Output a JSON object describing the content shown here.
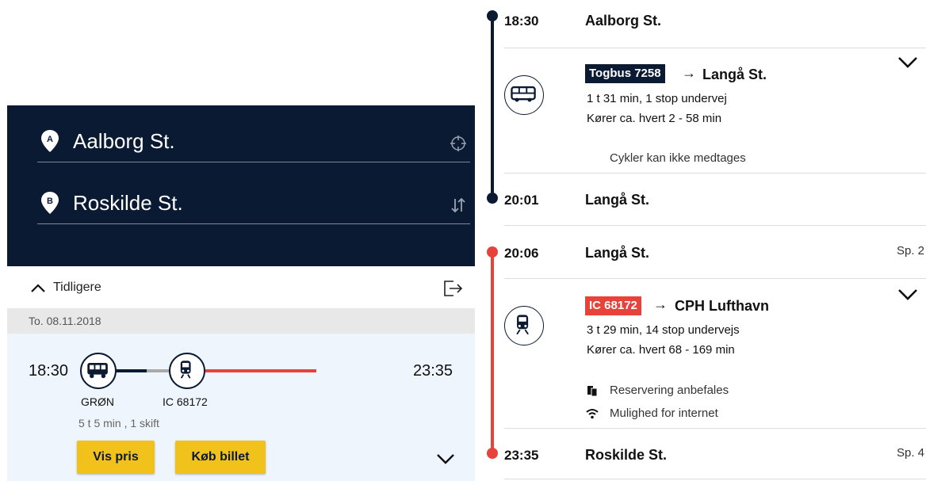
{
  "search": {
    "from_marker": "A",
    "from": "Aalborg St.",
    "to_marker": "B",
    "to": "Roskilde St.",
    "locate_icon": "crosshair-icon",
    "swap_icon": "swap-arrows-icon"
  },
  "results": {
    "earlier_label": "Tidligere",
    "date": "To. 08.11.2018",
    "trip": {
      "departure": "18:30",
      "arrival": "23:35",
      "legs": [
        {
          "icon": "bus-icon",
          "label": "GRØN"
        },
        {
          "icon": "train-icon",
          "label": "IC 68172"
        }
      ],
      "summary": "5 t 5 min , 1 skift",
      "price_button": "Vis pris",
      "buy_button": "Køb billet"
    }
  },
  "detail": {
    "colors": {
      "bus_line": "#0b1a33",
      "train_line": "#e8433a",
      "badge_bus": "#0b1a33",
      "badge_train": "#e8433a"
    },
    "leg1": {
      "start_time": "18:30",
      "start_stop": "Aalborg St.",
      "badge": "Togbus 7258",
      "arrow": "→",
      "destination": "Langå St.",
      "duration": "1 t 31 min, 1 stop undervej",
      "frequency": "Kører ca. hvert 2 - 58 min",
      "note": "Cykler kan ikke medtages",
      "end_time": "20:01",
      "end_stop": "Langå St."
    },
    "leg2": {
      "start_time": "20:06",
      "start_stop": "Langå St.",
      "start_track": "Sp. 2",
      "badge": "IC 68172",
      "arrow": "→",
      "destination": "CPH Lufthavn",
      "duration": "3 t 29 min, 14 stop undervejs",
      "frequency": "Kører ca. hvert 68 - 169 min",
      "note_reservation": "Reservering anbefales",
      "note_internet": "Mulighed for internet",
      "end_time": "23:35",
      "end_stop": "Roskilde St.",
      "end_track": "Sp. 4"
    }
  }
}
